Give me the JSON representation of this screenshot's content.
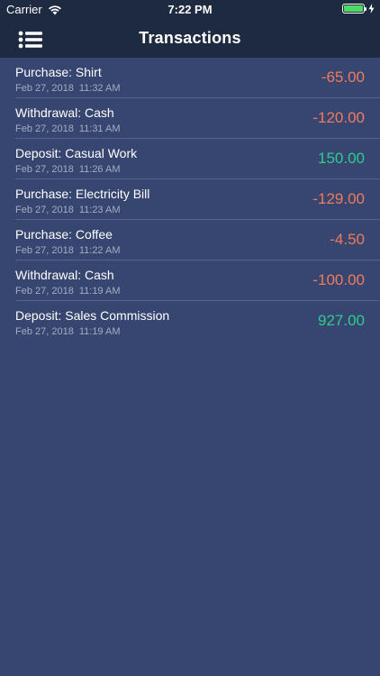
{
  "status_bar": {
    "carrier": "Carrier",
    "time": "7:22 PM",
    "battery_level": 1.0,
    "icons": [
      "wifi-icon",
      "battery-icon",
      "charging-bolt-icon"
    ]
  },
  "nav": {
    "title": "Transactions",
    "menu_icon": "list-menu-icon"
  },
  "colors": {
    "background": "#374670",
    "nav_background": "#1e2a3f",
    "negative": "#ef7b5e",
    "positive": "#2ecc8a",
    "subtext": "#a3acc4",
    "separator": "#56648a"
  },
  "transactions": [
    {
      "description": "Purchase: Shirt",
      "date": "Feb 27, 2018",
      "time": "11:32 AM",
      "amount": "-65.00",
      "sign": "negative"
    },
    {
      "description": "Withdrawal: Cash",
      "date": "Feb 27, 2018",
      "time": "11:31 AM",
      "amount": "-120.00",
      "sign": "negative"
    },
    {
      "description": "Deposit: Casual Work",
      "date": "Feb 27, 2018",
      "time": "11:26 AM",
      "amount": "150.00",
      "sign": "positive"
    },
    {
      "description": "Purchase: Electricity Bill",
      "date": "Feb 27, 2018",
      "time": "11:23 AM",
      "amount": "-129.00",
      "sign": "negative"
    },
    {
      "description": "Purchase: Coffee",
      "date": "Feb 27, 2018",
      "time": "11:22 AM",
      "amount": "-4.50",
      "sign": "negative"
    },
    {
      "description": "Withdrawal: Cash",
      "date": "Feb 27, 2018",
      "time": "11:19 AM",
      "amount": "-100.00",
      "sign": "negative"
    },
    {
      "description": "Deposit: Sales Commission",
      "date": "Feb 27, 2018",
      "time": "11:19 AM",
      "amount": "927.00",
      "sign": "positive"
    }
  ]
}
